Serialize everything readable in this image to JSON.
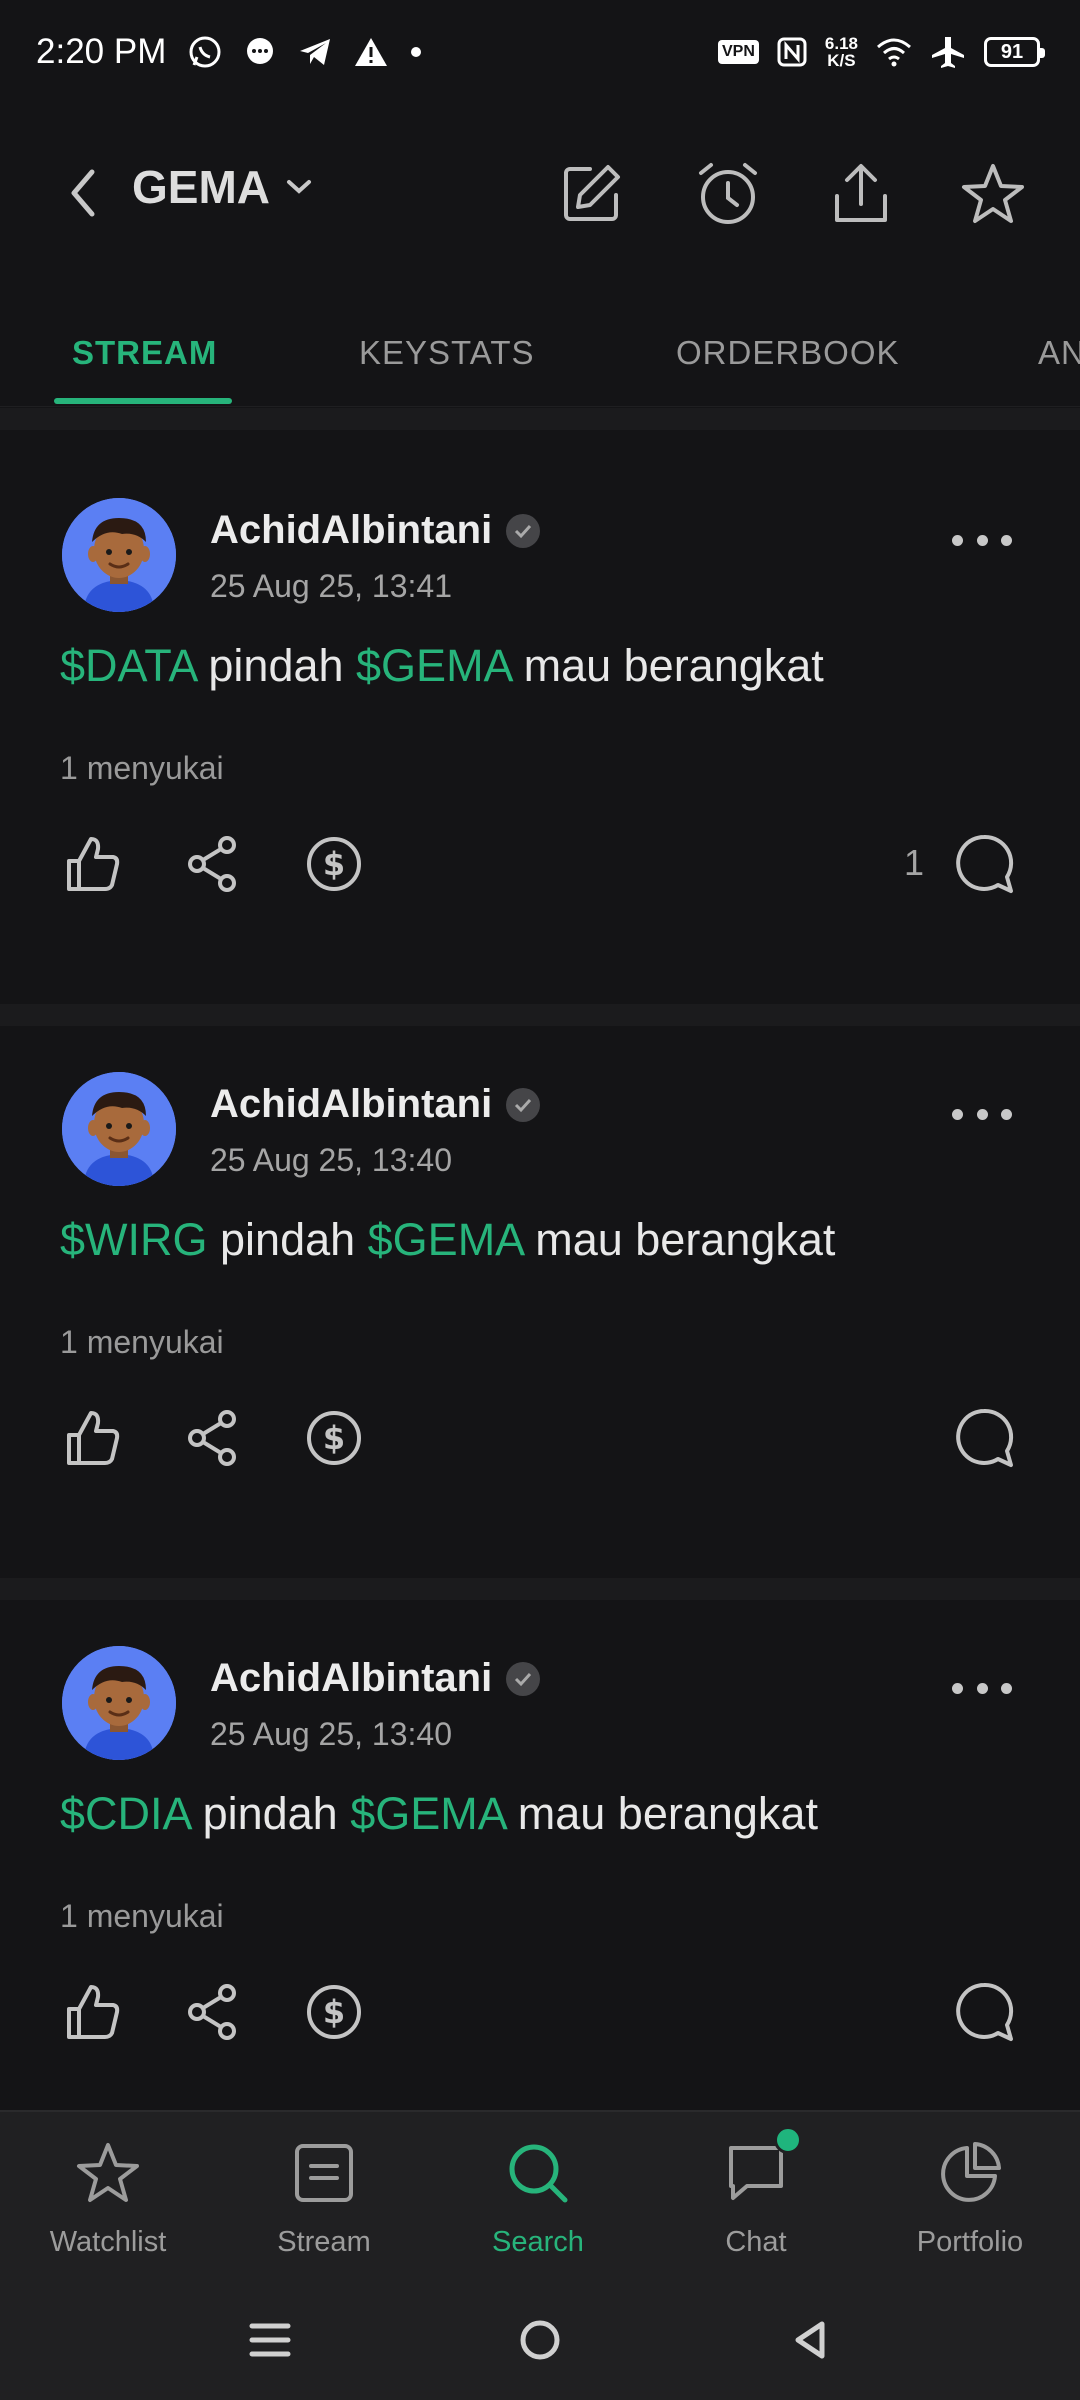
{
  "status_bar": {
    "time": "2:20 PM",
    "speed_value": "6.18",
    "speed_unit": "K/S",
    "vpn_label": "VPN",
    "battery": "91"
  },
  "header": {
    "ticker": "GEMA"
  },
  "tabs": [
    {
      "label": "STREAM",
      "active": true
    },
    {
      "label": "KEYSTATS",
      "active": false
    },
    {
      "label": "ORDERBOOK",
      "active": false
    },
    {
      "label": "AN",
      "active": false
    }
  ],
  "posts": [
    {
      "author": "AchidAlbintani",
      "timestamp": "25 Aug 25, 13:41",
      "content": {
        "tag1": "$DATA",
        "text1": " pindah ",
        "tag2": "$GEMA",
        "text2": " mau berangkat"
      },
      "likes_text": "1 menyukai",
      "comment_count": "1"
    },
    {
      "author": "AchidAlbintani",
      "timestamp": "25 Aug 25, 13:40",
      "content": {
        "tag1": "$WIRG",
        "text1": " pindah ",
        "tag2": "$GEMA",
        "text2": " mau berangkat"
      },
      "likes_text": "1 menyukai",
      "comment_count": ""
    },
    {
      "author": "AchidAlbintani",
      "timestamp": "25 Aug 25, 13:40",
      "content": {
        "tag1": "$CDIA",
        "text1": " pindah ",
        "tag2": "$GEMA",
        "text2": " mau berangkat"
      },
      "likes_text": "1 menyukai",
      "comment_count": ""
    }
  ],
  "bottom_nav": [
    {
      "label": "Watchlist",
      "icon": "star-icon",
      "active": false
    },
    {
      "label": "Stream",
      "icon": "document-icon",
      "active": false
    },
    {
      "label": "Search",
      "icon": "search-icon",
      "active": true
    },
    {
      "label": "Chat",
      "icon": "chat-icon",
      "active": false,
      "badge": true
    },
    {
      "label": "Portfolio",
      "icon": "pie-chart-icon",
      "active": false
    }
  ],
  "colors": {
    "accent": "#27b47b",
    "background": "#141416",
    "nav_background": "#202022"
  }
}
